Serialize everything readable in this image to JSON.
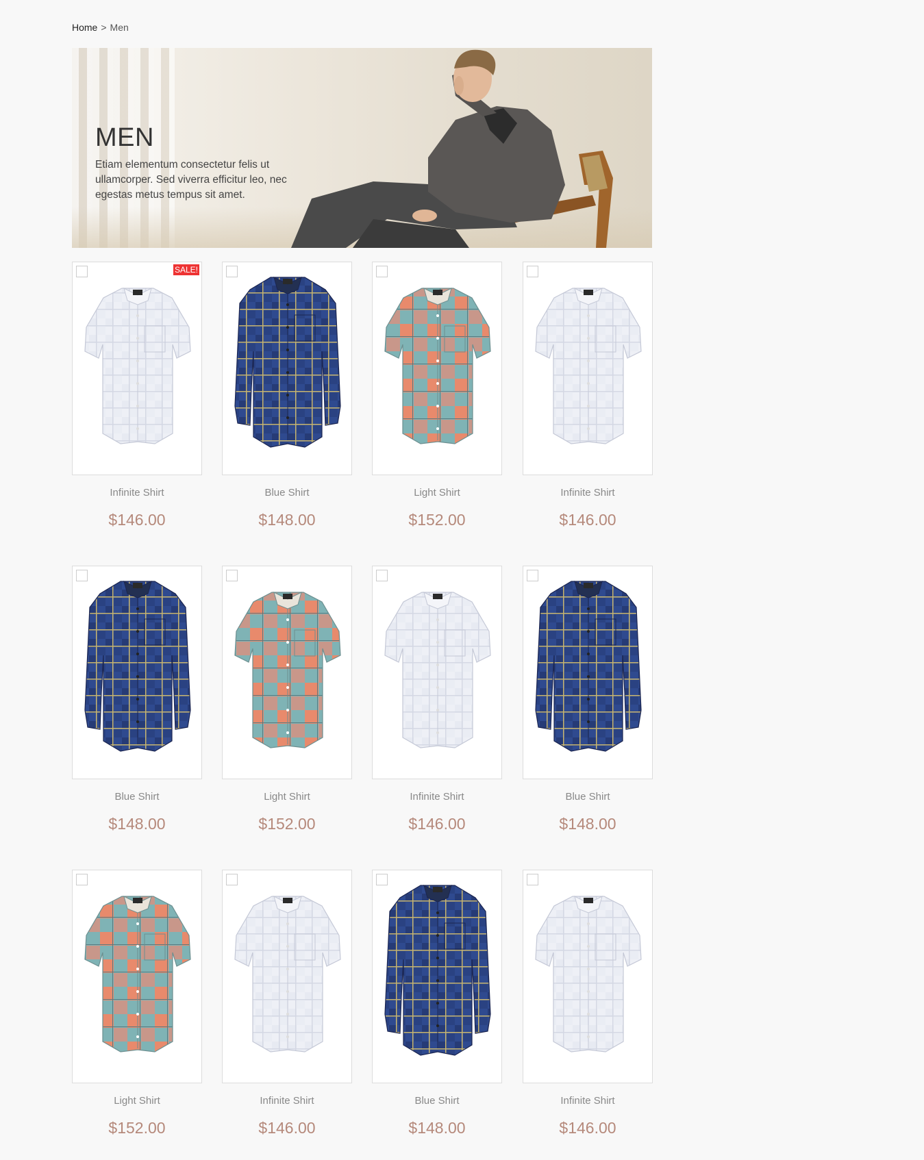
{
  "breadcrumb": {
    "home": "Home",
    "separator": ">",
    "current": "Men"
  },
  "hero": {
    "title": "MEN",
    "text": "Etiam elementum consectetur felis ut ullamcorper. Sed viverra efficitur leo, nec egestas metus tempus sit amet."
  },
  "colors": {
    "price": "#b5897b",
    "sale_badge": "#e33333",
    "name": "#888888"
  },
  "products": [
    {
      "name": "Infinite Shirt",
      "price": "$146.00",
      "style": "white-short",
      "sale": "SALE!"
    },
    {
      "name": "Blue Shirt",
      "price": "$148.00",
      "style": "blue-plaid-long"
    },
    {
      "name": "Light Shirt",
      "price": "$152.00",
      "style": "coral-plaid-short"
    },
    {
      "name": "Infinite Shirt",
      "price": "$146.00",
      "style": "white-short"
    },
    {
      "name": "Blue Shirt",
      "price": "$148.00",
      "style": "blue-plaid-long"
    },
    {
      "name": "Light Shirt",
      "price": "$152.00",
      "style": "coral-plaid-short"
    },
    {
      "name": "Infinite Shirt",
      "price": "$146.00",
      "style": "white-short"
    },
    {
      "name": "Blue Shirt",
      "price": "$148.00",
      "style": "blue-plaid-long"
    },
    {
      "name": "Light Shirt",
      "price": "$152.00",
      "style": "coral-plaid-short"
    },
    {
      "name": "Infinite Shirt",
      "price": "$146.00",
      "style": "white-short"
    },
    {
      "name": "Blue Shirt",
      "price": "$148.00",
      "style": "blue-plaid-long"
    },
    {
      "name": "Infinite Shirt",
      "price": "$146.00",
      "style": "white-short"
    }
  ]
}
